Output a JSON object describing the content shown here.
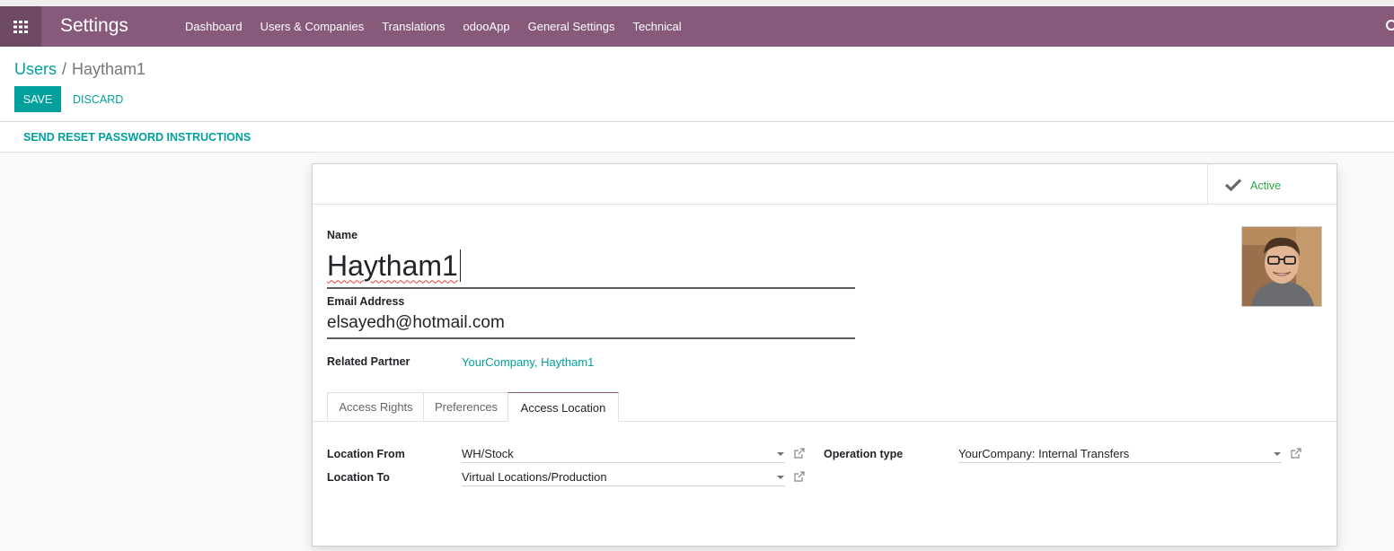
{
  "navbar": {
    "app_title": "Settings",
    "menu": [
      "Dashboard",
      "Users & Companies",
      "Translations",
      "odooApp",
      "General Settings",
      "Technical"
    ]
  },
  "breadcrumb": {
    "parent": "Users",
    "separator": "/",
    "current": "Haytham1"
  },
  "buttons": {
    "save": "SAVE",
    "discard": "DISCARD",
    "reset_password": "SEND RESET PASSWORD INSTRUCTIONS"
  },
  "status": {
    "active_label": "Active"
  },
  "form": {
    "name_label": "Name",
    "name_value": "Haytham1",
    "email_label": "Email Address",
    "email_value": "elsayedh@hotmail.com",
    "partner_label": "Related Partner",
    "partner_value": "YourCompany, Haytham1"
  },
  "tabs": [
    "Access Rights",
    "Preferences",
    "Access Location"
  ],
  "access_location": {
    "location_from_label": "Location From",
    "location_from_value": "WH/Stock",
    "location_to_label": "Location To",
    "location_to_value": "Virtual Locations/Production",
    "operation_type_label": "Operation type",
    "operation_type_value": "YourCompany: Internal Transfers"
  },
  "colors": {
    "brand": "#875a7b",
    "accent": "#00a09d",
    "active": "#28a745"
  }
}
